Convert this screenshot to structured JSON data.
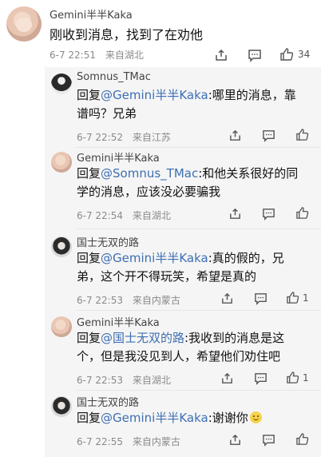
{
  "main_comment": {
    "author": "Gemini半半Kaka",
    "text": "刚收到消息，找到了在劝他",
    "time": "6-7 22:51",
    "location": "来自湖北",
    "likes": "34"
  },
  "replies": [
    {
      "author": "Somnus_TMac",
      "prefix": "回复",
      "mention": "@Gemini半半Kaka",
      "text_line1": ":哪里的消息，靠",
      "text_line2": "谱吗？兄弟",
      "time": "6-7 22:52",
      "location": "来自江苏",
      "likes": ""
    },
    {
      "author": "Gemini半半Kaka",
      "prefix": "回复",
      "mention": "@Somnus_TMac",
      "text_line1": ":和他关系很好的同",
      "text_line2": "学的消息，应该没必要骗我",
      "time": "6-7 22:54",
      "location": "来自湖北",
      "likes": ""
    },
    {
      "author": "国士无双的路",
      "prefix": "回复",
      "mention": "@Gemini半半Kaka",
      "text_line1": ":真的假的，兄",
      "text_line2": "弟，这个开不得玩笑，希望是真的",
      "time": "6-7 22:53",
      "location": "来自内蒙古",
      "likes": "1"
    },
    {
      "author": "Gemini半半Kaka",
      "prefix": "回复",
      "mention": "@国士无双的路",
      "text_line1": ":我收到的消息是这",
      "text_line2": "个，但是我没见到人，希望他们劝住吧",
      "time": "6-7 22:53",
      "location": "来自湖北",
      "likes": "1"
    },
    {
      "author": "国士无双的路",
      "prefix": "回复",
      "mention": "@Gemini半半Kaka",
      "text_line1": ":谢谢你",
      "text_line2": "",
      "time": "6-7 22:55",
      "location": "来自内蒙古",
      "likes": ""
    }
  ],
  "colors": {
    "mention": "#3d6fb3",
    "panel_bg": "#f5f5f5",
    "meta_text": "#8a8a8a"
  },
  "icons": [
    "share-icon",
    "comment-icon",
    "thumb-up-icon",
    "smile-emoji"
  ]
}
